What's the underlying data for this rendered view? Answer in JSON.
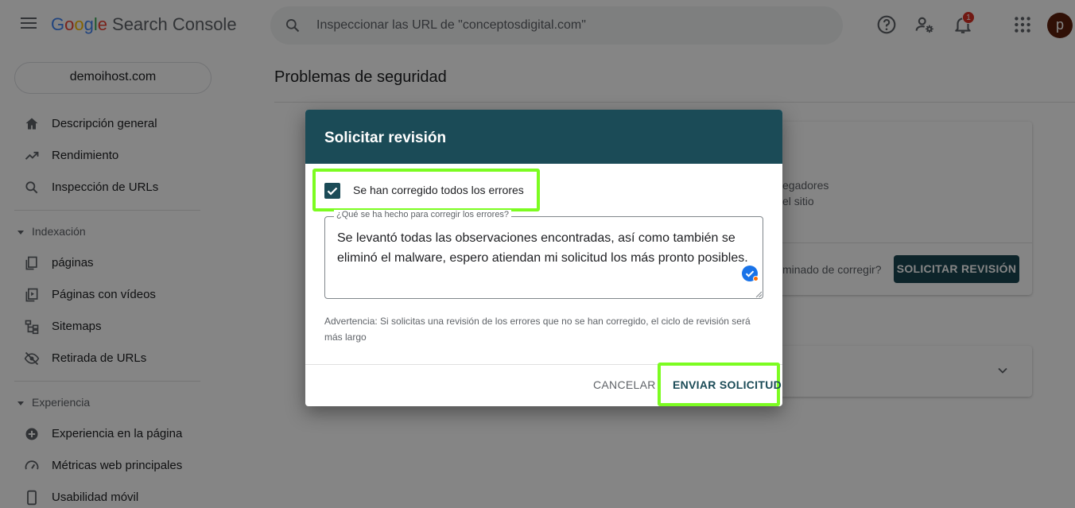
{
  "header": {
    "logo_letters": [
      "G",
      "o",
      "o",
      "g",
      "l",
      "e"
    ],
    "product_name": "Search Console",
    "search_text": "Inspeccionar las URL de \"conceptosdigital.com\"",
    "notification_count": "1",
    "avatar_letter": "p"
  },
  "sidebar": {
    "property": "demoihost.com",
    "items": [
      {
        "label": "Descripción general",
        "icon": "home-icon"
      },
      {
        "label": "Rendimiento",
        "icon": "trending-up-icon"
      },
      {
        "label": "Inspección de URLs",
        "icon": "search-icon"
      }
    ],
    "section_indexing": "Indexación",
    "indexing_items": [
      {
        "label": "páginas",
        "icon": "pages-icon"
      },
      {
        "label": "Páginas con vídeos",
        "icon": "video-page-icon"
      },
      {
        "label": "Sitemaps",
        "icon": "sitemap-icon"
      },
      {
        "label": "Retirada de URLs",
        "icon": "eye-off-icon"
      }
    ],
    "section_experience": "Experiencia",
    "experience_items": [
      {
        "label": "Experiencia en la página",
        "icon": "plus-circle-icon"
      },
      {
        "label": "Métricas web principales",
        "icon": "speed-icon"
      },
      {
        "label": "Usabilidad móvil",
        "icon": "phone-icon"
      }
    ]
  },
  "main": {
    "title": "Problemas de seguridad",
    "card_text_1": "egadores",
    "card_text_2": "el sitio",
    "card_question": "minado de corregir?",
    "request_button": "SOLICITAR REVISIÓN"
  },
  "dialog": {
    "title": "Solicitar revisión",
    "checkbox_label": "Se han corregido todos los errores",
    "checkbox_checked": true,
    "field_label": "¿Qué se ha hecho para corregir los errores?",
    "field_value": "Se levantó todas las observaciones encontradas, así como también se eliminó el malware, espero atiendan mi solicitud los más pronto posibles.",
    "warning": "Advertencia: Si solicitas una revisión de los errores que no se han corregido, el ciclo de revisión será más largo",
    "cancel_label": "CANCELAR",
    "send_label": "ENVIAR SOLICITUD"
  },
  "colors": {
    "dialog_header": "#1b4b57",
    "highlight": "#7cfc21",
    "notification_badge": "#d93025"
  }
}
